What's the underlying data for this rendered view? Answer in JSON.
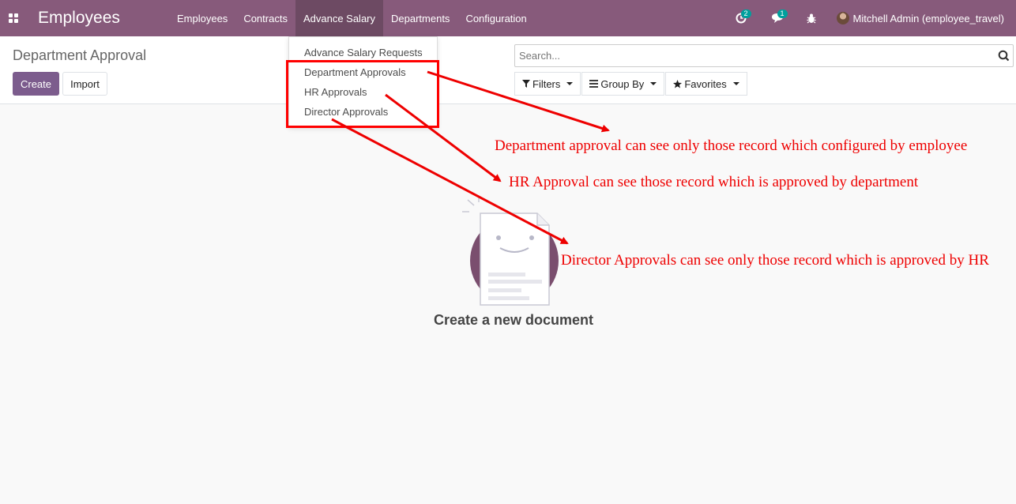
{
  "navbar": {
    "app_title": "Employees",
    "menu": [
      "Employees",
      "Contracts",
      "Advance Salary",
      "Departments",
      "Configuration"
    ],
    "activity_badge": "2",
    "messages_badge": "1",
    "user_name": "Mitchell Admin (employee_travel)"
  },
  "dropdown": {
    "items": [
      "Advance Salary Requests",
      "Department Approvals",
      "HR Approvals",
      "Director Approvals"
    ]
  },
  "control": {
    "breadcrumb": "Department Approval",
    "create_label": "Create",
    "import_label": "Import",
    "search_placeholder": "Search...",
    "filters_label": "Filters",
    "groupby_label": "Group By",
    "favorites_label": "Favorites"
  },
  "help": {
    "title": "Create a new document"
  },
  "annotations": {
    "department": "Department approval can see only those record which configured by employee",
    "hr": "HR Approval can see those record which is approved by department",
    "director": "Director Approvals can see only those record which is approved by HR"
  },
  "colors": {
    "navbar": "#875a7b",
    "primary": "#7c5c8d",
    "annotation": "#ee0000"
  }
}
